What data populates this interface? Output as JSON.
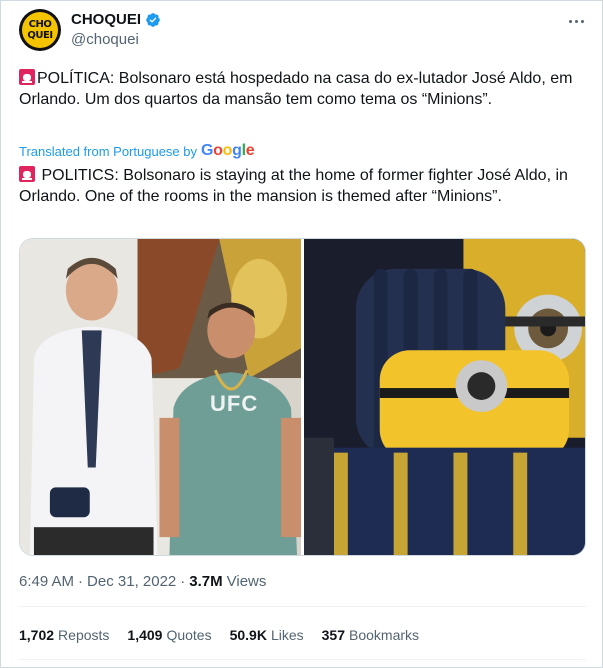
{
  "account": {
    "display_name": "CHOQUEI",
    "handle": "@choquei",
    "avatar_text": [
      "CHO",
      "QUEI"
    ],
    "verified_color": "#1d9bf0"
  },
  "tweet": {
    "original_text": "POLÍTICA: Bolsonaro está hospedado na casa do ex-lutador José Aldo, em Orlando. Um dos quartos da mansão tem como tema os “Minions”.",
    "translated_label": "Translated from Portuguese by",
    "translator_brand": "Google",
    "translated_text": " POLITICS: Bolsonaro is staying at the home of former fighter José Aldo, in Orlando. One of the rooms in the mansion is themed after “Minions”."
  },
  "media": {
    "photos": [
      {
        "icon": "photo-two-men"
      },
      {
        "icon": "photo-minion-bedroom",
        "shirt_text": "UFC"
      }
    ],
    "shirt_text": "UFC"
  },
  "meta": {
    "time": "6:49 AM",
    "separator": "·",
    "date": "Dec 31, 2022",
    "views_count": "3.7M",
    "views_label": "Views"
  },
  "stats": [
    {
      "count": "1,702",
      "label": "Reposts"
    },
    {
      "count": "1,409",
      "label": "Quotes"
    },
    {
      "count": "50.9K",
      "label": "Likes"
    },
    {
      "count": "357",
      "label": "Bookmarks"
    }
  ],
  "colors": {
    "text": "#0f1419",
    "secondary": "#536471",
    "link": "#1d9bf0",
    "siren": "#e0245e"
  }
}
